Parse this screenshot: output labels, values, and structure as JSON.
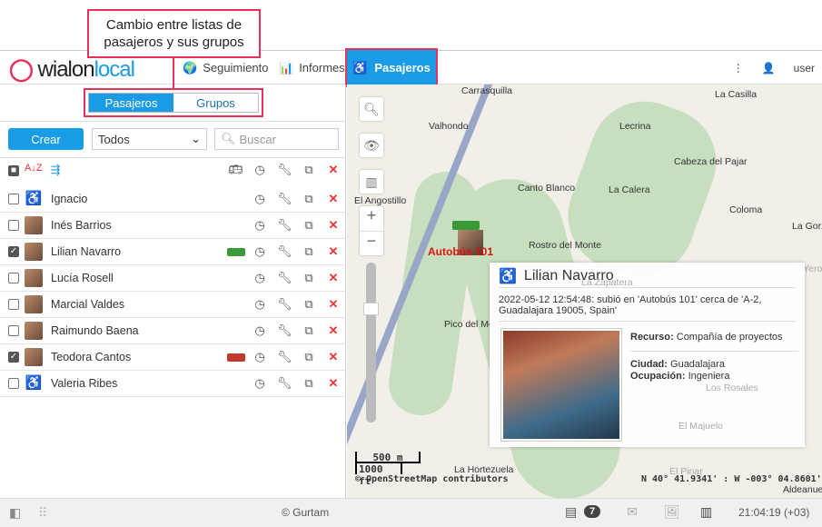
{
  "callout": {
    "text": "Cambio entre listas de pasajeros y sus grupos"
  },
  "header": {
    "logo_a": "wialon",
    "logo_b": "local",
    "nav": [
      {
        "label": "Seguimiento"
      },
      {
        "label": "Informes"
      },
      {
        "label": "Pasajeros"
      }
    ],
    "user": "user"
  },
  "left": {
    "tabs": [
      {
        "label": "Pasajeros"
      },
      {
        "label": "Grupos"
      }
    ],
    "create": "Crear",
    "filter": "Todos",
    "search_placeholder": "Buscar",
    "passengers": [
      {
        "name": "Ignacio",
        "checked": false,
        "avatar": "chair",
        "bus": ""
      },
      {
        "name": "Inés Barrios",
        "checked": false,
        "avatar": "photo",
        "bus": ""
      },
      {
        "name": "Lilian Navarro",
        "checked": true,
        "avatar": "photo",
        "bus": "#3a9a3a"
      },
      {
        "name": "Lucía Rosell",
        "checked": false,
        "avatar": "photo",
        "bus": ""
      },
      {
        "name": "Marcial Valdes",
        "checked": false,
        "avatar": "photo",
        "bus": ""
      },
      {
        "name": "Raimundo Baena",
        "checked": false,
        "avatar": "photo",
        "bus": ""
      },
      {
        "name": "Teodora Cantos",
        "checked": true,
        "avatar": "photo",
        "bus": "#c0392b"
      },
      {
        "name": "Valeria Ribes",
        "checked": false,
        "avatar": "chair",
        "bus": ""
      }
    ]
  },
  "map": {
    "labels": [
      "Carrasquilla",
      "La Casilla",
      "Valhondo",
      "Lecrina",
      "Cabeza del Pajar",
      "El Angostillo",
      "Canto Blanco",
      "La Calera",
      "Coloma",
      "Rostro del Monte",
      "Pico del Monte",
      "La Hortezuela",
      "La Zapatera",
      "El Pinar",
      "Los Rosales",
      "El Majuelo",
      "La Gorz",
      "El Yero",
      "Aldeanue"
    ],
    "unit_label": "Autobús 101",
    "scale_m": "500 m",
    "scale_ft": "1000 ft",
    "attribution": "© OpenStreetMap contributors",
    "coords": "N 40° 41.9341' : W -003° 04.8601'",
    "popup": {
      "name": "Lilian Navarro",
      "event": "2022-05-12 12:54:48: subió en 'Autobús 101' cerca de 'A-2, Guadalajara 19005, Spain'",
      "recurso_label": "Recurso:",
      "recurso": "Compañía de proyectos",
      "ciudad_label": "Ciudad:",
      "ciudad": "Guadalajara",
      "ocupacion_label": "Ocupación:",
      "ocupacion": "Ingeniera"
    }
  },
  "footer": {
    "copyright": "© Gurtam",
    "notifications": "7",
    "time": "21:04:19 (+03)"
  }
}
